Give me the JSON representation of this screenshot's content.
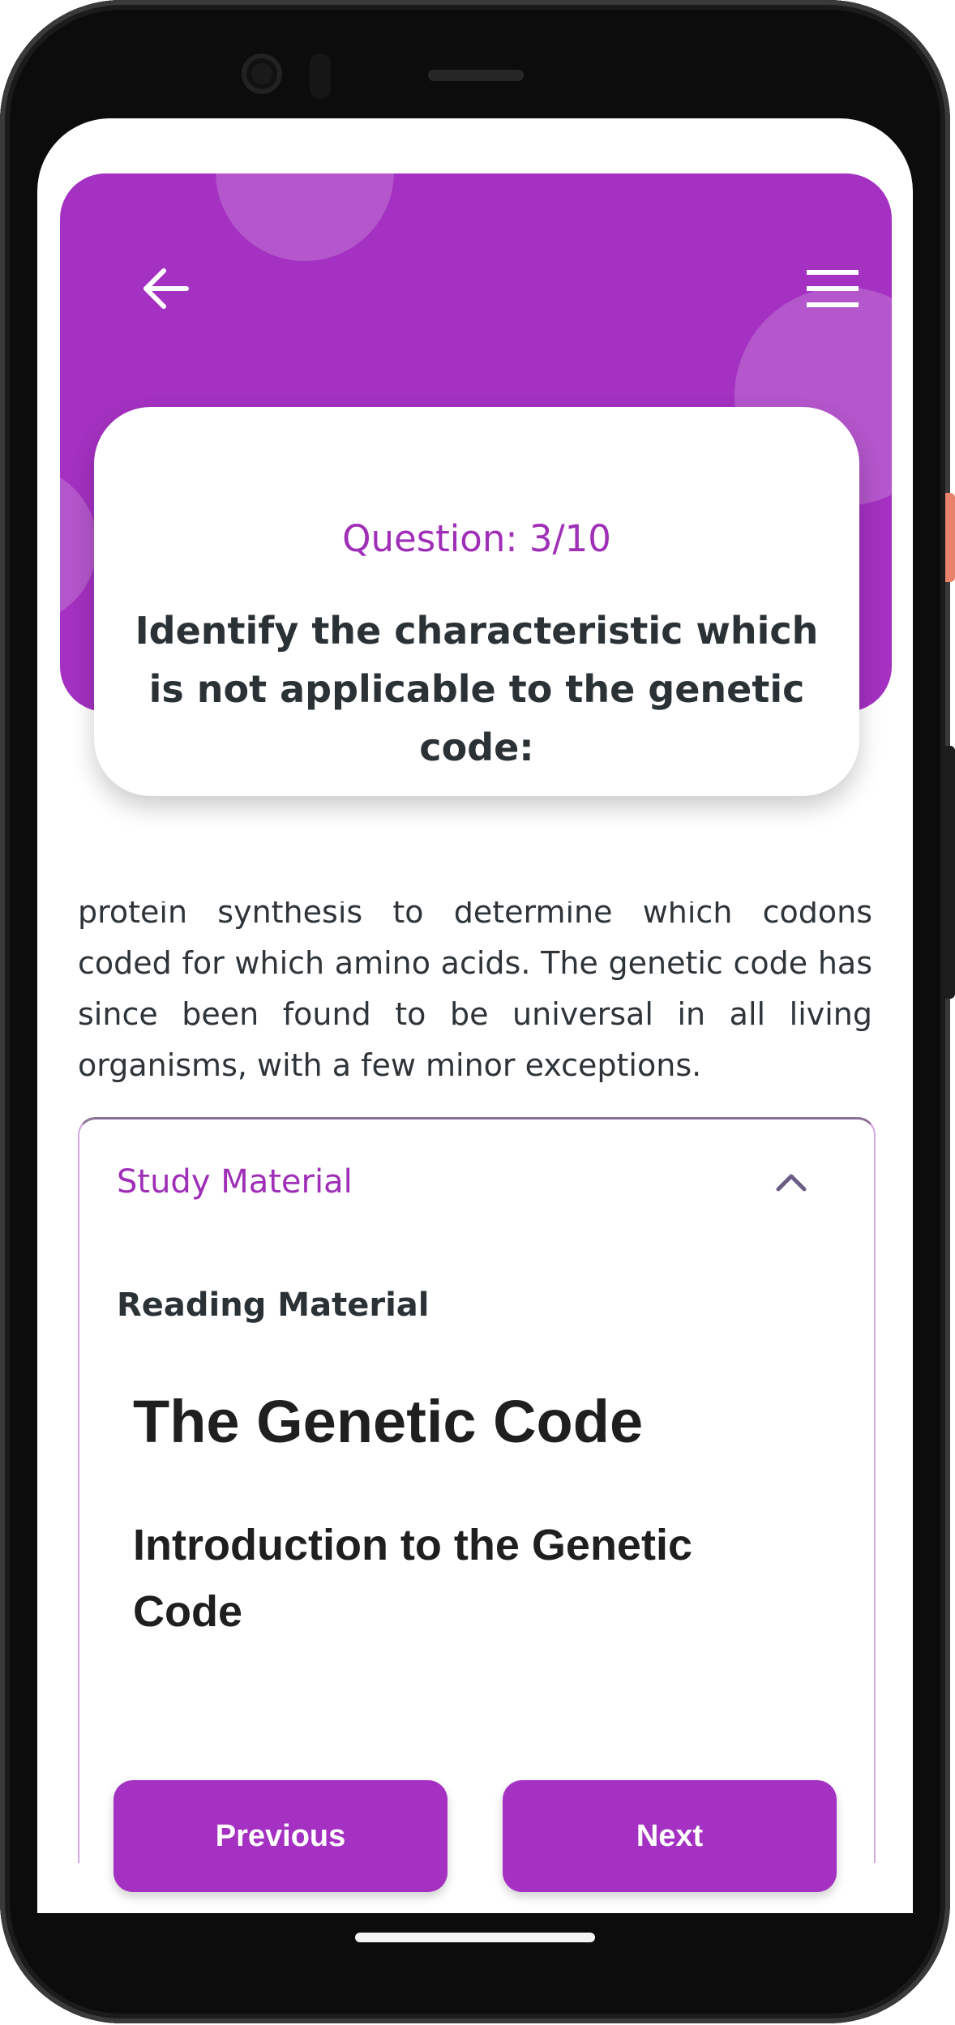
{
  "colors": {
    "accent": "#a431c1",
    "accent_text": "#a02fb8",
    "text_dark": "#2b3236",
    "panel_border": "#d4a9df"
  },
  "header": {
    "back_icon": "arrow-left-icon",
    "menu_icon": "hamburger-menu-icon"
  },
  "question": {
    "number_label": "Question: 3/10",
    "text": "Identify the characteristic which is not applicable to the genetic code:"
  },
  "content": {
    "paragraph": "protein synthesis to determine which codons coded for which amino acids. The genetic code has since been found to be universal in all living organisms, with a few minor exceptions."
  },
  "study_material": {
    "title": "Study Material",
    "toggle_icon": "chevron-up-icon",
    "reading_label": "Reading Material",
    "doc_title": "The Genetic Code",
    "doc_subtitle": "Introduction to the Genetic Code"
  },
  "footer": {
    "previous_label": "Previous",
    "next_label": "Next"
  }
}
